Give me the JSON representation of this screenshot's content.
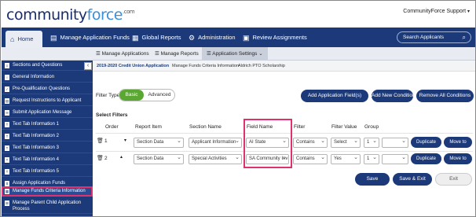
{
  "header": {
    "logo_text": "community",
    "logo_accent": "force",
    "logo_suffix": ".com",
    "support_label": "CommunityForce Support",
    "support_caret": "▾"
  },
  "nav": {
    "home": "Home",
    "manage_funds": "Manage Application Funds",
    "global_reports": "Global Reports",
    "administration": "Administration",
    "review_assignments": "Review Assignments",
    "search_placeholder": "Search Applicants"
  },
  "subnav": {
    "manage_applications": "Manage Applications",
    "manage_reports": "Manage Reports",
    "application_settings": "Application Settings"
  },
  "sidebar": {
    "items": [
      "Sections and Questions",
      "General Information",
      "Pre-Qualification Questions",
      "Request Instructions to Applicant",
      "Submit Application Message",
      "Text Tab Information 1",
      "Text Tab Information 2",
      "Text Tab Information 3",
      "Text Tab Information 4",
      "Text Tab Information 5",
      "Assign Application Funds",
      "Manage Funds Criteria Information",
      "Manage Parent Child Application Process"
    ]
  },
  "breadcrumb": {
    "c1": "2019-2020 Credit Union Application",
    "c2": "Manage Funds Criteria Information",
    "c3": "Aldrich PTO Scholarship"
  },
  "filter": {
    "type_label": "Filter Type:",
    "basic": "Basic",
    "advanced": "Advanced",
    "add_fields": "Add Application Field(s)",
    "add_condition": "Add New Condition",
    "remove_all": "Remove All Conditions",
    "select_filters": "Select Filters"
  },
  "table": {
    "headers": {
      "order": "Order",
      "report_item": "Report Item",
      "section_name": "Section Name",
      "field_name": "Field Name",
      "filter": "Filter",
      "filter_value": "Filter Value",
      "group": "Group"
    },
    "rows": [
      {
        "order": "1",
        "report_item": "Section Data",
        "section_name": "Applicant Information",
        "field_name": "AI State",
        "filter": "Contains",
        "filter_value": "Select",
        "group": "1",
        "duplicate": "Duplicate",
        "move_to": "Move to"
      },
      {
        "order": "2",
        "report_item": "Section Data",
        "section_name": "Special Activities",
        "field_name": "SA Community Inv",
        "filter": "Contains",
        "filter_value": "Yes",
        "group": "1",
        "duplicate": "Duplicate",
        "move_to": "Move to"
      }
    ]
  },
  "actions": {
    "save": "Save",
    "save_exit": "Save & Exit",
    "exit": "Exit"
  },
  "colors": {
    "navy": "#1c3a7a",
    "green": "#5aa832",
    "highlight": "#e0316e"
  }
}
